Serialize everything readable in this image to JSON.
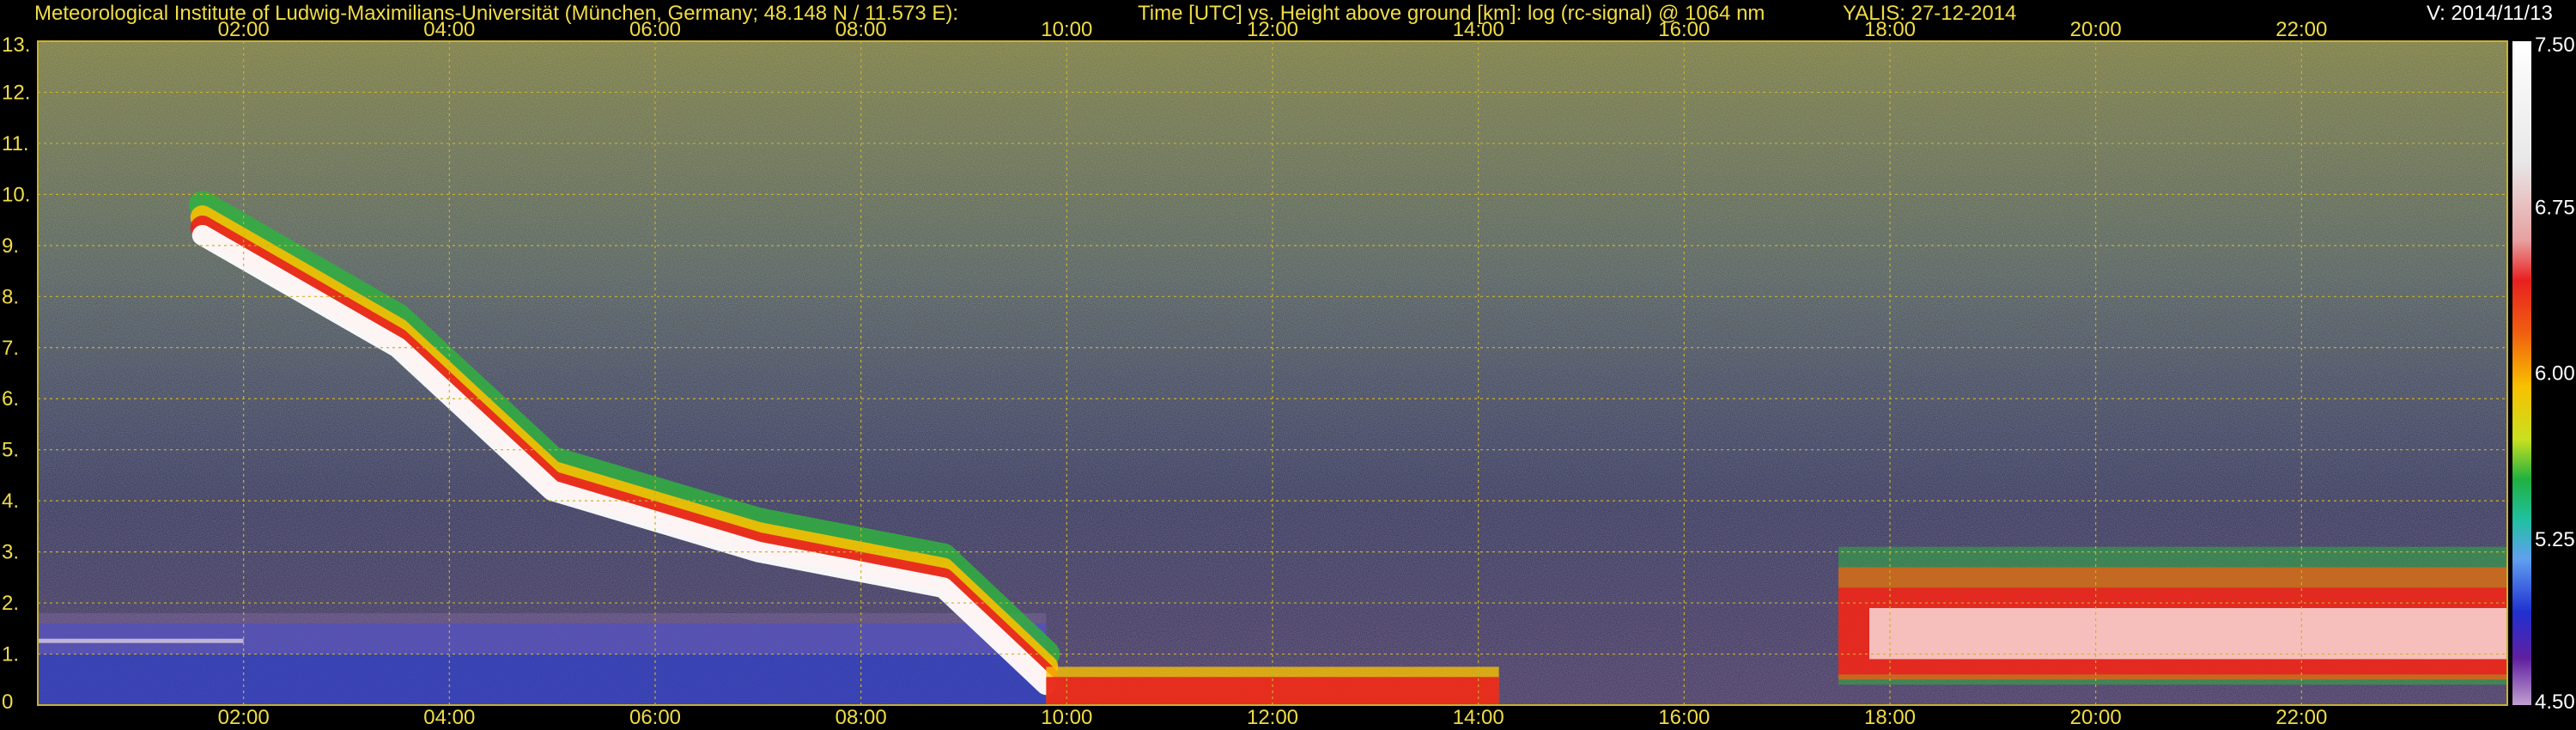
{
  "header": {
    "institute": "Meteorological Institute of Ludwig-Maximilians-Universität (München, Germany; 48.148 N / 11.573 E):",
    "axes_desc": "Time [UTC] vs. Height above ground [km]: log (rc-signal) @ 1064 nm",
    "instrument_date": "YALIS: 27-12-2014",
    "version": "V: 2014/11/13"
  },
  "chart_data": {
    "type": "heatmap",
    "title": "Time [UTC] vs. Height above ground [km]: log (rc-signal) @ 1064 nm",
    "xlabel": "Time [UTC]",
    "ylabel": "Height above ground [km]",
    "x_ticks": [
      "02:00",
      "04:00",
      "06:00",
      "08:00",
      "10:00",
      "12:00",
      "14:00",
      "16:00",
      "18:00",
      "20:00",
      "22:00"
    ],
    "y_ticks": [
      "0",
      "1.",
      "2.",
      "3.",
      "4.",
      "5.",
      "6.",
      "7.",
      "8.",
      "9.",
      "10.",
      "11.",
      "12.",
      "13."
    ],
    "xlim_hours": [
      0,
      24
    ],
    "ylim_km": [
      0,
      13
    ],
    "grid": true,
    "colorbar": {
      "label_values": [
        "7.50",
        "6.75",
        "6.00",
        "5.25",
        "4.50"
      ],
      "range": [
        4.5,
        7.5
      ]
    },
    "features": [
      {
        "name": "elevated cloud/aerosol layer",
        "time_start_h": 1.6,
        "time_end_h": 9.8,
        "height_start_km": 9.2,
        "height_end_km": 0.4
      },
      {
        "name": "boundary layer",
        "time_start_h": 0.0,
        "time_end_h": 9.8,
        "height_km": 1.3
      },
      {
        "name": "low cloud layer",
        "time_start_h": 9.8,
        "time_end_h": 14.2,
        "height_km": 0.4
      },
      {
        "name": "low cloud field",
        "time_start_h": 17.5,
        "time_end_h": 24.0,
        "height_km": 1.5
      }
    ],
    "colors": {
      "grid": "#c9b22a",
      "text": "#f0dc46"
    }
  }
}
